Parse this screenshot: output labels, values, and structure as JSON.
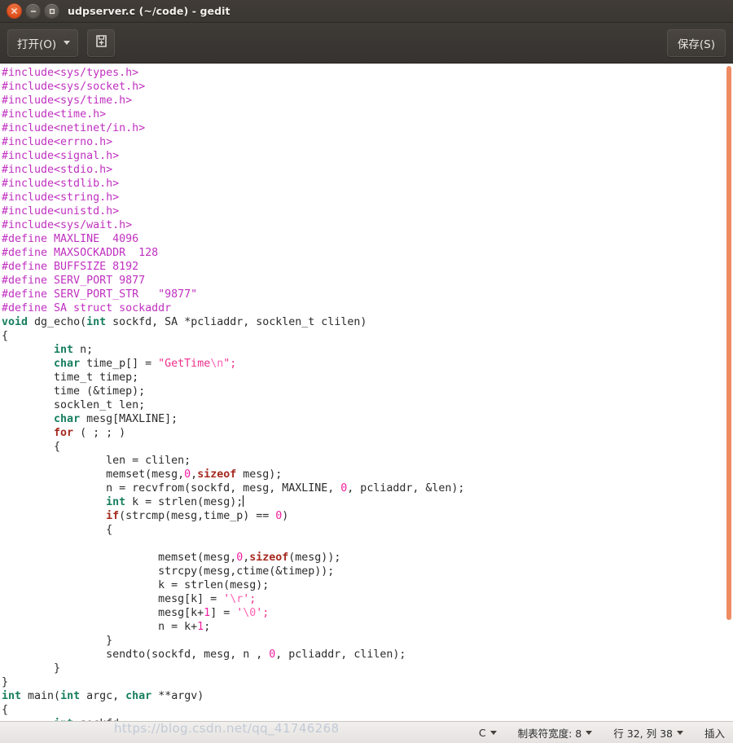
{
  "window": {
    "title": "udpserver.c (~/code) - gedit",
    "controls": [
      {
        "name": "close",
        "glyph": "×"
      },
      {
        "name": "minimize",
        "glyph": "–"
      },
      {
        "name": "maximize",
        "glyph": "□"
      }
    ]
  },
  "toolbar": {
    "open_label": "打开(O)",
    "save_label": "保存(S)",
    "new_icon": "new-document-icon"
  },
  "statusbar": {
    "language": "C",
    "tab_width_label": "制表符宽度: 8",
    "position_label": "行 32, 列 38",
    "insert_mode": "插入",
    "watermark": "https://blog.csdn.net/qq_41746268"
  },
  "editor": {
    "scroll_thumb_color": "#ef8b62",
    "lines": [
      [
        {
          "t": "#include<sys/types.h>",
          "c": "pp"
        }
      ],
      [
        {
          "t": "#include<sys/socket.h>",
          "c": "pp"
        }
      ],
      [
        {
          "t": "#include<sys/time.h>",
          "c": "pp"
        }
      ],
      [
        {
          "t": "#include<time.h>",
          "c": "pp"
        }
      ],
      [
        {
          "t": "#include<netinet/in.h>",
          "c": "pp"
        }
      ],
      [
        {
          "t": "#include<errno.h>",
          "c": "pp"
        }
      ],
      [
        {
          "t": "#include<signal.h>",
          "c": "pp"
        }
      ],
      [
        {
          "t": "#include<stdio.h>",
          "c": "pp"
        }
      ],
      [
        {
          "t": "#include<stdlib.h>",
          "c": "pp"
        }
      ],
      [
        {
          "t": "#include<string.h>",
          "c": "pp"
        }
      ],
      [
        {
          "t": "#include<unistd.h>",
          "c": "pp"
        }
      ],
      [
        {
          "t": "#include<sys/wait.h>",
          "c": "pp"
        }
      ],
      [
        {
          "t": "#define MAXLINE  4096",
          "c": "pp"
        }
      ],
      [
        {
          "t": "#define MAXSOCKADDR  128",
          "c": "pp"
        }
      ],
      [
        {
          "t": "#define BUFFSIZE 8192",
          "c": "pp"
        }
      ],
      [
        {
          "t": "#define SERV_PORT 9877",
          "c": "pp"
        }
      ],
      [
        {
          "t": "#define SERV_PORT_STR   \"9877\"",
          "c": "pp"
        }
      ],
      [
        {
          "t": "#define SA struct sockaddr",
          "c": "pp"
        }
      ],
      [
        {
          "t": "void",
          "c": "kw"
        },
        {
          "t": " dg_echo(",
          "c": ""
        },
        {
          "t": "int",
          "c": "kw"
        },
        {
          "t": " sockfd, SA *pcliaddr, socklen_t clilen)",
          "c": ""
        }
      ],
      [
        {
          "t": "{",
          "c": ""
        }
      ],
      [
        {
          "t": "        ",
          "c": ""
        },
        {
          "t": "int",
          "c": "kw"
        },
        {
          "t": " n;",
          "c": ""
        }
      ],
      [
        {
          "t": "        ",
          "c": ""
        },
        {
          "t": "char",
          "c": "kw"
        },
        {
          "t": " time_p[] = ",
          "c": ""
        },
        {
          "t": "\"GetTime",
          "c": "str"
        },
        {
          "t": "\\n",
          "c": "esc"
        },
        {
          "t": "\";",
          "c": "str"
        }
      ],
      [
        {
          "t": "        time_t timep;",
          "c": ""
        }
      ],
      [
        {
          "t": "        time (&timep);",
          "c": ""
        }
      ],
      [
        {
          "t": "        socklen_t len;",
          "c": ""
        }
      ],
      [
        {
          "t": "        ",
          "c": ""
        },
        {
          "t": "char",
          "c": "kw"
        },
        {
          "t": " mesg[MAXLINE];",
          "c": ""
        }
      ],
      [
        {
          "t": "        ",
          "c": ""
        },
        {
          "t": "for",
          "c": "kw2"
        },
        {
          "t": " ( ; ; )",
          "c": ""
        }
      ],
      [
        {
          "t": "        {",
          "c": ""
        }
      ],
      [
        {
          "t": "                len = clilen;",
          "c": ""
        }
      ],
      [
        {
          "t": "                memset(mesg,",
          "c": ""
        },
        {
          "t": "0",
          "c": "num"
        },
        {
          "t": ",",
          "c": ""
        },
        {
          "t": "sizeof",
          "c": "kw2"
        },
        {
          "t": " mesg);",
          "c": ""
        }
      ],
      [
        {
          "t": "                n = recvfrom(sockfd, mesg, MAXLINE, ",
          "c": ""
        },
        {
          "t": "0",
          "c": "num"
        },
        {
          "t": ", pcliaddr, &len);",
          "c": ""
        }
      ],
      [
        {
          "t": "                ",
          "c": ""
        },
        {
          "t": "int",
          "c": "kw"
        },
        {
          "t": " k = strlen(mesg);",
          "c": ""
        },
        {
          "t": "|CURSOR|",
          "c": "cursor"
        }
      ],
      [
        {
          "t": "                ",
          "c": ""
        },
        {
          "t": "if",
          "c": "kw2"
        },
        {
          "t": "(strcmp(mesg,time_p) == ",
          "c": ""
        },
        {
          "t": "0",
          "c": "num"
        },
        {
          "t": ")",
          "c": ""
        }
      ],
      [
        {
          "t": "                {",
          "c": ""
        }
      ],
      [
        {
          "t": "",
          "c": ""
        }
      ],
      [
        {
          "t": "                        memset(mesg,",
          "c": ""
        },
        {
          "t": "0",
          "c": "num"
        },
        {
          "t": ",",
          "c": ""
        },
        {
          "t": "sizeof",
          "c": "kw2"
        },
        {
          "t": "(mesg));",
          "c": ""
        }
      ],
      [
        {
          "t": "                        strcpy(mesg,ctime(&timep));",
          "c": ""
        }
      ],
      [
        {
          "t": "                        k = strlen(mesg);",
          "c": ""
        }
      ],
      [
        {
          "t": "                        mesg[k] = ",
          "c": ""
        },
        {
          "t": "'",
          "c": "str"
        },
        {
          "t": "\\r",
          "c": "esc"
        },
        {
          "t": "';",
          "c": "str"
        }
      ],
      [
        {
          "t": "                        mesg[k+",
          "c": ""
        },
        {
          "t": "1",
          "c": "num"
        },
        {
          "t": "] = ",
          "c": ""
        },
        {
          "t": "'",
          "c": "str"
        },
        {
          "t": "\\0",
          "c": "esc"
        },
        {
          "t": "';",
          "c": "str"
        }
      ],
      [
        {
          "t": "                        n = k+",
          "c": ""
        },
        {
          "t": "1",
          "c": "num"
        },
        {
          "t": ";",
          "c": ""
        }
      ],
      [
        {
          "t": "                }",
          "c": ""
        }
      ],
      [
        {
          "t": "                sendto(sockfd, mesg, n , ",
          "c": ""
        },
        {
          "t": "0",
          "c": "num"
        },
        {
          "t": ", pcliaddr, clilen);",
          "c": ""
        }
      ],
      [
        {
          "t": "        }",
          "c": ""
        }
      ],
      [
        {
          "t": "}",
          "c": ""
        }
      ],
      [
        {
          "t": "int",
          "c": "kw"
        },
        {
          "t": " main(",
          "c": ""
        },
        {
          "t": "int",
          "c": "kw"
        },
        {
          "t": " argc, ",
          "c": ""
        },
        {
          "t": "char",
          "c": "kw"
        },
        {
          "t": " **argv)",
          "c": ""
        }
      ],
      [
        {
          "t": "{",
          "c": ""
        }
      ],
      [
        {
          "t": "        ",
          "c": ""
        },
        {
          "t": "int",
          "c": "kw"
        },
        {
          "t": " sockfd;",
          "c": ""
        }
      ]
    ]
  }
}
